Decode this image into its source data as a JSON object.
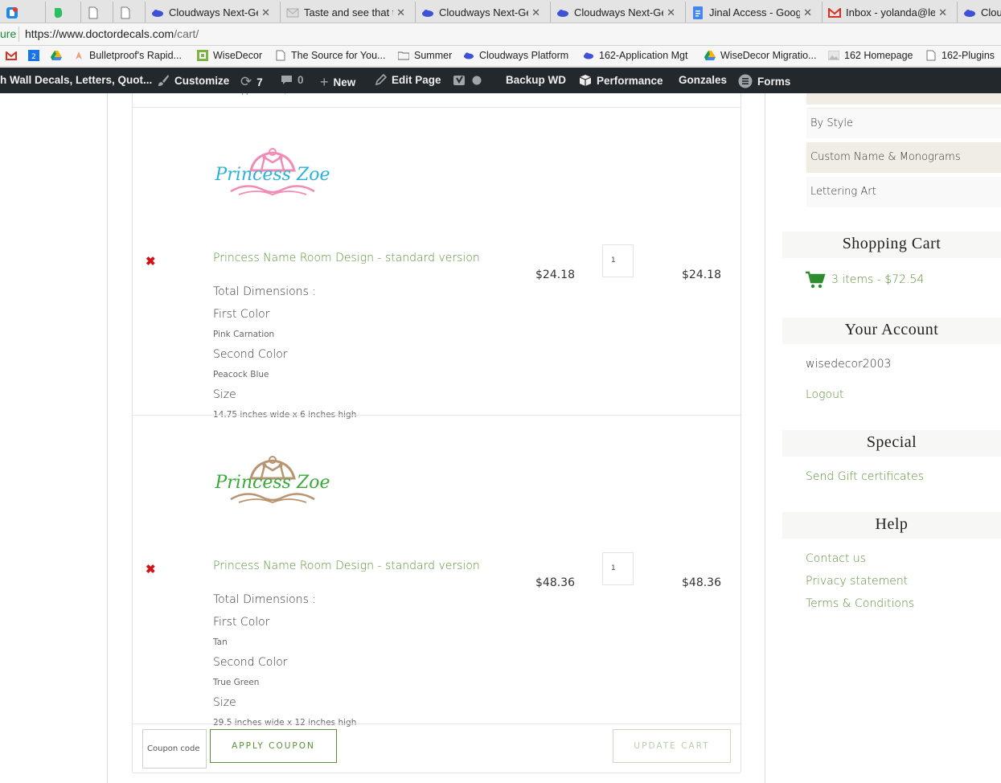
{
  "browser": {
    "tabs": [
      {
        "title": "",
        "icon": "tab-icon-blue"
      },
      {
        "title": "",
        "icon": "evernote-icon"
      },
      {
        "title": "",
        "icon": "document-icon"
      },
      {
        "title": "",
        "icon": "document-icon"
      },
      {
        "title": "Cloudways Next-Ge",
        "icon": "cloudways-icon"
      },
      {
        "title": "Taste and see that t",
        "icon": "mail-icon"
      },
      {
        "title": "Cloudways Next-Ge",
        "icon": "cloudways-icon"
      },
      {
        "title": "Cloudways Next-Ge",
        "icon": "cloudways-icon"
      },
      {
        "title": "Jinal Access - Goog",
        "icon": "google-docs-icon"
      },
      {
        "title": "Inbox - yolanda@le",
        "icon": "gmail-icon"
      },
      {
        "title": "Cloud",
        "icon": "cloudways-icon"
      }
    ],
    "secure_label": "ure",
    "url_host": "https://www.doctordecals.com",
    "url_path": "/cart/",
    "bookmarks": [
      {
        "label": "",
        "icon": "gmail-icon"
      },
      {
        "label": "",
        "icon": "calendar-icon"
      },
      {
        "label": "",
        "icon": "drive-icon"
      },
      {
        "label": "Bulletproof's Rapid...",
        "icon": "bulletproof-icon"
      },
      {
        "label": "WiseDecor",
        "icon": "wisedecor-icon"
      },
      {
        "label": "The Source for You...",
        "icon": "page-icon"
      },
      {
        "label": "Summer",
        "icon": "folder-icon"
      },
      {
        "label": "Cloudways Platform",
        "icon": "cloudways-icon"
      },
      {
        "label": "162-Application Mgt",
        "icon": "cloudways-icon"
      },
      {
        "label": "WiseDecor Migratio...",
        "icon": "drive-icon"
      },
      {
        "label": "162 Homepage",
        "icon": "image-icon"
      },
      {
        "label": "162-Plugins",
        "icon": "page-icon"
      }
    ]
  },
  "adminbar": {
    "site_name": "h Wall Decals, Letters, Quot...",
    "customize": "Customize",
    "updates_count": "7",
    "comments_count": "0",
    "new_label": "New",
    "edit_page": "Edit Page",
    "backup": "Backup WD",
    "performance": "Performance",
    "user": "Gonzales",
    "forms": "Forms"
  },
  "cart": {
    "prev_item_color": "Color:  Apple-Green ;",
    "items": [
      {
        "logo_text": "Princess Zoe",
        "logo_crown_color": "#f08cb5",
        "logo_text_color": "#2bb2d6",
        "name": "Princess Name Room Design - standard version",
        "price": "$24.18",
        "quantity": "1",
        "subtotal": "$24.18",
        "total_dimensions_label": "Total Dimensions :",
        "first_color_label": "First Color",
        "first_color": "Pink Carnation",
        "second_color_label": "Second Color",
        "second_color": "Peacock Blue",
        "size_label": "Size",
        "size": "14.75 inches wide x 6 inches high"
      },
      {
        "logo_text": "Princess Zoe",
        "logo_crown_color": "#b89472",
        "logo_text_color": "#3aa83a",
        "name": "Princess Name Room Design - standard version",
        "price": "$48.36",
        "quantity": "1",
        "subtotal": "$48.36",
        "total_dimensions_label": "Total Dimensions :",
        "first_color_label": "First Color",
        "first_color": "Tan",
        "second_color_label": "Second Color",
        "second_color": "True Green",
        "size_label": "Size",
        "size": "29.5 inches wide x 12 inches high"
      }
    ],
    "coupon_placeholder": "Coupon code",
    "apply_coupon": "APPLY COUPON",
    "update_cart": "UPDATE CART"
  },
  "sidebar": {
    "categories": [
      "By Style",
      "Custom Name & Monograms",
      "Lettering Art"
    ],
    "shopping_cart_title": "Shopping Cart",
    "cart_summary": "3 items - $72.54",
    "account_title": "Your Account",
    "username": "wisedecor2003",
    "logout": "Logout",
    "special_title": "Special",
    "gift": "Send Gift certificates",
    "help_title": "Help",
    "help_links": [
      "Contact us",
      "Privacy statement",
      "Terms & Conditions"
    ]
  },
  "colors": {
    "accent_green": "#5a8f3a",
    "remove_red": "#d0121b",
    "admin_bar": "#23282d"
  }
}
